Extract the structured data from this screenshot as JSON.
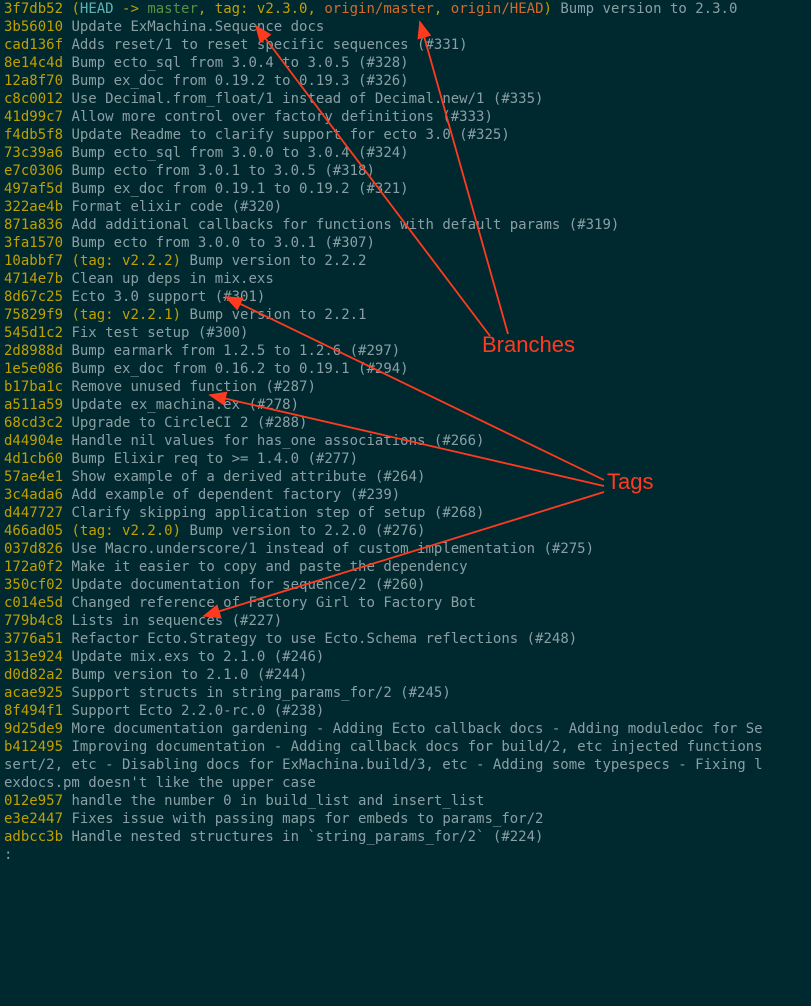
{
  "annotations": {
    "branches_label": "Branches",
    "tags_label": "Tags"
  },
  "prompt": ":",
  "commits": [
    {
      "hash": "3f7db52",
      "refs": [
        {
          "type": "head",
          "text": "HEAD"
        },
        {
          "type": "arrow",
          "text": " -> "
        },
        {
          "type": "branch-local",
          "text": "master"
        },
        {
          "type": "comma",
          "text": ", "
        },
        {
          "type": "tag",
          "text": "tag: v2.3.0"
        },
        {
          "type": "comma",
          "text": ", "
        },
        {
          "type": "branch-remote",
          "text": "origin/master"
        },
        {
          "type": "comma",
          "text": ", "
        },
        {
          "type": "branch-remote",
          "text": "origin/HEAD"
        }
      ],
      "message": "Bump version to 2.3.0"
    },
    {
      "hash": "3b56010",
      "refs": [],
      "message": "Update ExMachina.Sequence docs"
    },
    {
      "hash": "cad136f",
      "refs": [],
      "message": "Adds reset/1 to reset specific sequences (#331)"
    },
    {
      "hash": "8e14c4d",
      "refs": [],
      "message": "Bump ecto_sql from 3.0.4 to 3.0.5 (#328)"
    },
    {
      "hash": "12a8f70",
      "refs": [],
      "message": "Bump ex_doc from 0.19.2 to 0.19.3 (#326)"
    },
    {
      "hash": "c8c0012",
      "refs": [],
      "message": "Use Decimal.from_float/1 instead of Decimal.new/1 (#335)"
    },
    {
      "hash": "41d99c7",
      "refs": [],
      "message": "Allow more control over factory definitions (#333)"
    },
    {
      "hash": "f4db5f8",
      "refs": [],
      "message": "Update Readme to clarify support for ecto 3.0 (#325)"
    },
    {
      "hash": "73c39a6",
      "refs": [],
      "message": "Bump ecto_sql from 3.0.0 to 3.0.4 (#324)"
    },
    {
      "hash": "e7c0306",
      "refs": [],
      "message": "Bump ecto from 3.0.1 to 3.0.5 (#318)"
    },
    {
      "hash": "497af5d",
      "refs": [],
      "message": "Bump ex_doc from 0.19.1 to 0.19.2 (#321)"
    },
    {
      "hash": "322ae4b",
      "refs": [],
      "message": "Format elixir code (#320)"
    },
    {
      "hash": "871a836",
      "refs": [],
      "message": "Add additional callbacks for functions with default params (#319)"
    },
    {
      "hash": "3fa1570",
      "refs": [],
      "message": "Bump ecto from 3.0.0 to 3.0.1 (#307)"
    },
    {
      "hash": "10abbf7",
      "refs": [
        {
          "type": "tag",
          "text": "tag: v2.2.2"
        }
      ],
      "message": "Bump version to 2.2.2"
    },
    {
      "hash": "4714e7b",
      "refs": [],
      "message": "Clean up deps in mix.exs"
    },
    {
      "hash": "8d67c25",
      "refs": [],
      "message": "Ecto 3.0 support (#301)"
    },
    {
      "hash": "75829f9",
      "refs": [
        {
          "type": "tag",
          "text": "tag: v2.2.1"
        }
      ],
      "message": "Bump version to 2.2.1"
    },
    {
      "hash": "545d1c2",
      "refs": [],
      "message": "Fix test setup (#300)"
    },
    {
      "hash": "2d8988d",
      "refs": [],
      "message": "Bump earmark from 1.2.5 to 1.2.6 (#297)"
    },
    {
      "hash": "1e5e086",
      "refs": [],
      "message": "Bump ex_doc from 0.16.2 to 0.19.1 (#294)"
    },
    {
      "hash": "b17ba1c",
      "refs": [],
      "message": "Remove unused function (#287)"
    },
    {
      "hash": "a511a59",
      "refs": [],
      "message": "Update ex_machina.ex (#278)"
    },
    {
      "hash": "68cd3c2",
      "refs": [],
      "message": "Upgrade to CircleCI 2 (#288)"
    },
    {
      "hash": "d44904e",
      "refs": [],
      "message": "Handle nil values for has_one associations (#266)"
    },
    {
      "hash": "4d1cb60",
      "refs": [],
      "message": "Bump Elixir req to >= 1.4.0 (#277)"
    },
    {
      "hash": "57ae4e1",
      "refs": [],
      "message": "Show example of a derived attribute (#264)"
    },
    {
      "hash": "3c4ada6",
      "refs": [],
      "message": "Add example of dependent factory (#239)"
    },
    {
      "hash": "d447727",
      "refs": [],
      "message": "Clarify skipping application step of setup (#268)"
    },
    {
      "hash": "466ad05",
      "refs": [
        {
          "type": "tag",
          "text": "tag: v2.2.0"
        }
      ],
      "message": "Bump version to 2.2.0 (#276)"
    },
    {
      "hash": "037d826",
      "refs": [],
      "message": "Use Macro.underscore/1 instead of custom implementation (#275)"
    },
    {
      "hash": "172a0f2",
      "refs": [],
      "message": "Make it easier to copy and paste the dependency"
    },
    {
      "hash": "350cf02",
      "refs": [],
      "message": "Update documentation for sequence/2 (#260)"
    },
    {
      "hash": "c014e5d",
      "refs": [],
      "message": "Changed reference of Factory Girl to Factory Bot"
    },
    {
      "hash": "779b4c8",
      "refs": [],
      "message": "Lists in sequences (#227)"
    },
    {
      "hash": "3776a51",
      "refs": [],
      "message": "Refactor Ecto.Strategy to use Ecto.Schema reflections (#248)"
    },
    {
      "hash": "313e924",
      "refs": [],
      "message": "Update mix.exs to 2.1.0 (#246)"
    },
    {
      "hash": "d0d82a2",
      "refs": [],
      "message": "Bump version to 2.1.0 (#244)"
    },
    {
      "hash": "acae925",
      "refs": [],
      "message": "Support structs in string_params_for/2 (#245)"
    },
    {
      "hash": "8f494f1",
      "refs": [],
      "message": "Support Ecto 2.2.0-rc.0 (#238)"
    },
    {
      "hash": "9d25de9",
      "refs": [],
      "message": "More documentation gardening - Adding Ecto callback docs - Adding moduledoc for Se"
    },
    {
      "hash": "b412495",
      "refs": [],
      "message": "Improving documentation - Adding callback docs for build/2, etc injected functions"
    }
  ],
  "wrapped_lines": [
    "sert/2, etc - Disabling docs for ExMachina.build/3, etc - Adding some typespecs - Fixing l",
    "exdocs.pm doesn't like the upper case"
  ],
  "trailing_commits": [
    {
      "hash": "012e957",
      "refs": [],
      "message": "handle the number 0 in build_list and insert_list"
    },
    {
      "hash": "e3e2447",
      "refs": [],
      "message": "Fixes issue with passing maps for embeds to params_for/2"
    },
    {
      "hash": "adbcc3b",
      "refs": [],
      "message": "Handle nested structures in `string_params_for/2` (#224)"
    }
  ]
}
